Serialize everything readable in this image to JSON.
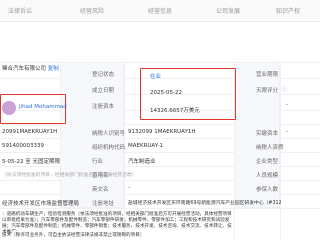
{
  "tabs": [
    "法律诉讼",
    "经营风险",
    "经营信息",
    "公司发展",
    "知识产权"
  ],
  "company": {
    "name_fragment": "稀合汽车有限公司",
    "edit_link": "复制",
    "legal_rep": "Jihad Mohammad"
  },
  "left_column": {
    "credit_code": "20991MAEKRUAY1H",
    "reg_number": "591400003339",
    "period": "5-05-22 至 无固定期限",
    "approve_note": "（依法须经批准的项目，经相关部门批准后方可开展经营活动）",
    "authority": "经济技术开发区市场监督管理局",
    "scope_1": "：道路机动车辆生产；检验检测服务（依法须经批准的项目，经相关部门批准后方可开展经营活动，具体经营项目以审批结果为准）；汽车零部件及配件制造；汽车零部件研发；机械零件、零部件加工；工程和技术研究和试验发展；汽车零部件及配件制造；机械零件、零部件销售；技术服务、技术开发、技术咨询、技术交流、技术转让、技术推广；",
    "scope_2": "技术（除许可业务外，可自主依法经营法律法规非禁止或限制的项目）"
  },
  "middle": {
    "labels": [
      "登记状态",
      "成立日期",
      "注册资本",
      "实缴资本",
      "纳税人识别号",
      "组织机构代码",
      "行业",
      "曾用名",
      "英文名",
      "注册地址"
    ],
    "status": "在业",
    "founded": "2025-05-22",
    "capital": "14326.6657万美元",
    "paid_capital": "-",
    "taxpayer_id": "9132099 1MAEKRUAY1H",
    "org_code": "MAEKRUAY-1",
    "industry": "汽车制造业",
    "former_name": "-",
    "english_name": "-",
    "address": "盐城经济技术开发区东环南路69号新能源汽车产业园区研发中心（#312"
  },
  "right": {
    "labels": [
      "营业期限",
      "天眼评分",
      "经营状态",
      "实缴资本",
      "纳税人资质",
      "企业类型",
      "人员规模",
      "参保人数"
    ],
    "score_value": "-",
    "dash": "-"
  },
  "colors": {
    "highlight_box": "#e3342f",
    "link": "#2f6fd8"
  }
}
